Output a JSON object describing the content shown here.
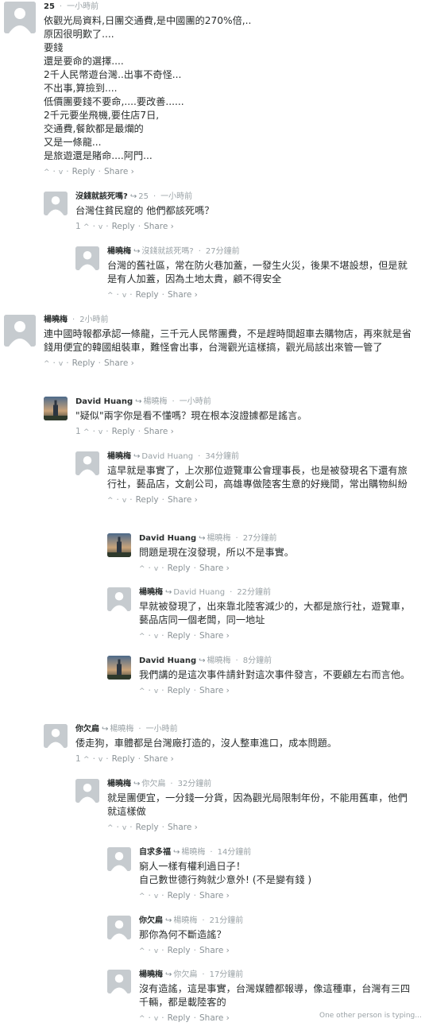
{
  "labels": {
    "reply": "Reply",
    "share": "Share ›",
    "upvote": "^",
    "downvote": "v",
    "separator": "·",
    "reply_arrow": "↪"
  },
  "typing_indicator": "One other person is typing...",
  "comments": [
    {
      "author": "25",
      "reply_to": "",
      "time": "一小時前",
      "votes": "",
      "lines": [
        "依觀光局資料,日團交通費,是中國團的270%倍,..",
        "原因很明歎了....",
        "要錢",
        "還是要命的選擇....",
        "2千人民幣遊台灣..出事不奇怪...",
        "不出事,算撿到....",
        "低價團要錢不要命,....要改善......",
        "2千元要坐飛機,要住店7日,",
        "交通費,餐飲都是最爛的",
        "又是一條龍...",
        "是旅遊還是賭命....阿門..."
      ]
    },
    {
      "author": "沒錢就該死嗎?",
      "reply_to": "25",
      "time": "一小時前",
      "votes": "1",
      "lines": [
        "台灣住貧民窟的 他們都該死嗎？"
      ]
    },
    {
      "author": "楊曉梅",
      "reply_to": "沒錢就該死嗎?",
      "time": "27分鐘前",
      "votes": "",
      "lines": [
        "台灣的舊社區，常在防火巷加蓋，一發生火災，後果不堪設想，但是就是有人加蓋，因為土地太貴，顧不得安全"
      ]
    },
    {
      "author": "楊曉梅",
      "reply_to": "",
      "time": "2小時前",
      "votes": "",
      "lines": [
        "連中國時報都承認一條龍，三千元人民幣團費，不是趕時間超車去購物店，再來就是省錢用便宜的韓國組裝車，難怪會出事，台灣觀光這樣搞，觀光局該出來管一管了"
      ]
    },
    {
      "author": "David Huang",
      "reply_to": "楊曉梅",
      "time": "一小時前",
      "votes": "1",
      "lines": [
        "\"疑似\"兩字你是看不懂嗎？現在根本沒證據都是謠言。"
      ]
    },
    {
      "author": "楊曉梅",
      "reply_to": "David Huang",
      "time": "34分鐘前",
      "votes": "",
      "lines": [
        "這早就是事實了，上次那位遊覽車公會理事長，也是被發現名下還有旅行社，藝品店，文創公司，高雄專做陸客生意的好幾間，常出購物糾紛"
      ]
    },
    {
      "author": "David Huang",
      "reply_to": "楊曉梅",
      "time": "27分鐘前",
      "votes": "",
      "lines": [
        "問題是現在沒發現，所以不是事實。"
      ]
    },
    {
      "author": "楊曉梅",
      "reply_to": "David Huang",
      "time": "22分鐘前",
      "votes": "",
      "lines": [
        "早就被發現了，出來靠北陸客減少的，大都是旅行社，遊覽車，藝品店同一個老闆，同一地址"
      ]
    },
    {
      "author": "David Huang",
      "reply_to": "楊曉梅",
      "time": "8分鐘前",
      "votes": "",
      "lines": [
        "我們講的是這次事件請針對這次事件發言，不要顧左右而言他。"
      ]
    },
    {
      "author": "你欠扁",
      "reply_to": "楊曉梅",
      "time": "一小時前",
      "votes": "1",
      "lines": [
        "倭走狗，車體都是台灣廠打造的，沒人整車進口，成本問題。"
      ]
    },
    {
      "author": "楊曉梅",
      "reply_to": "你欠扁",
      "time": "32分鐘前",
      "votes": "",
      "lines": [
        "就是團便宜，一分錢一分貨，因為觀光局限制年份，不能用舊車，他們就這樣做"
      ]
    },
    {
      "author": "自求多福",
      "reply_to": "楊曉梅",
      "time": "14分鐘前",
      "votes": "",
      "lines": [
        "窮人一樣有權利過日子！",
        "自己數世德行夠就少意外! (不是變有錢 )"
      ]
    },
    {
      "author": "你欠扁",
      "reply_to": "楊曉梅",
      "time": "21分鐘前",
      "votes": "",
      "lines": [
        "那你為何不斷造謠？"
      ]
    },
    {
      "author": "楊曉梅",
      "reply_to": "你欠扁",
      "time": "17分鐘前",
      "votes": "",
      "lines": [
        "沒有造謠，這是事實，台灣媒體都報導，像這種車，台灣有三四千輛，都是載陸客的"
      ]
    }
  ]
}
